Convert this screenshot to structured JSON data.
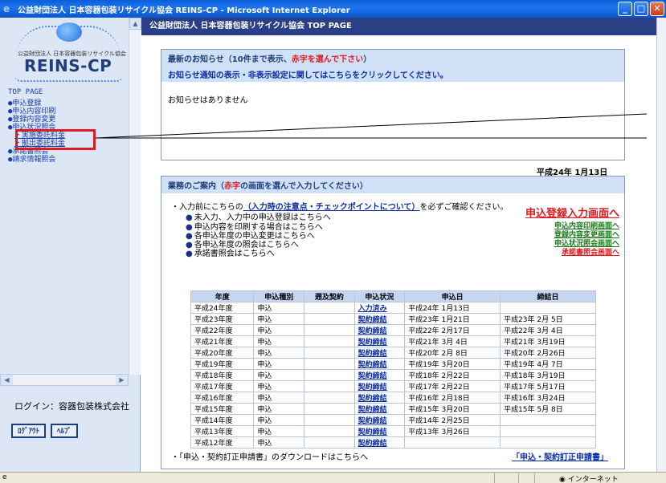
{
  "window": {
    "title": "公益財団法人 日本容器包装リサイクル協会 REINS-CP - Microsoft Internet Explorer"
  },
  "logo": {
    "subtitle": "公益財団法人 日本容器包装リサイクル協会",
    "main": "REINS-CP"
  },
  "nav": {
    "items": [
      {
        "label": "TOP PAGE"
      },
      {
        "label": "●申込登録"
      },
      {
        "label": "●申込内容印刷"
      },
      {
        "label": "●登録内容変更"
      },
      {
        "label": "●申込状況照会"
      },
      {
        "label": "・実施委託料金"
      },
      {
        "label": "・拠出委託料金"
      },
      {
        "label": "●承諾書照会"
      },
      {
        "label": "●請求情報照会"
      }
    ]
  },
  "login": {
    "text": "ログイン：容器包装株式会社"
  },
  "buttons": {
    "logout": "ﾛｸﾞｱｳﾄ",
    "help": "ﾍﾙﾌﾟ"
  },
  "main": {
    "header": "公益財団法人 日本容器包装リサイクル協会 TOP PAGE",
    "notice_title_prefix": "最新のお知らせ（10件まで表示、",
    "notice_title_red": "赤字を選んで下さい",
    "notice_title_suffix": "）",
    "notice_link": "お知らせ通知の表示・非表示設定に関してはこちらをクリックしてください。",
    "notice_empty": "お知らせはありません",
    "date": "平成24年 1月13日",
    "guide_title_prefix": "業務のご案内（",
    "guide_title_red": "赤字",
    "guide_title_suffix": "の画面を選んで入力してください）",
    "pre_check_prefix": "・入力前にこちらの",
    "pre_check_link": "（入力時の注意点・チェックポイントについて）",
    "pre_check_suffix": "を必ずご確認ください。",
    "actions": [
      {
        "text": "未入力、入力中の申込登録はこちらへ",
        "link": "申込登録入力画面へ"
      },
      {
        "text": "申込内容を印刷する場合はこちらへ",
        "link": "申込内容印刷画面へ"
      },
      {
        "text": "各申込年度の申込変更はこちらへ",
        "link": "登録内容変更画面へ"
      },
      {
        "text": "各申込年度の照会はこちらへ",
        "link": "申込状況照会画面へ"
      },
      {
        "text": "承諾書照会はこちらへ",
        "link": "承諾書照会画面へ"
      }
    ],
    "table": {
      "headers": [
        "年度",
        "申込種別",
        "遡及契約",
        "申込状況",
        "申込日",
        "締結日"
      ],
      "rows": [
        [
          "平成24年度",
          "申込",
          "",
          "入力済み",
          "平成24年 1月13日",
          ""
        ],
        [
          "平成23年度",
          "申込",
          "",
          "契約締結",
          "平成23年 1月21日",
          "平成23年 2月 5日"
        ],
        [
          "平成22年度",
          "申込",
          "",
          "契約締結",
          "平成22年 2月17日",
          "平成22年 3月 4日"
        ],
        [
          "平成21年度",
          "申込",
          "",
          "契約締結",
          "平成21年 3月 4日",
          "平成21年 3月19日"
        ],
        [
          "平成20年度",
          "申込",
          "",
          "契約締結",
          "平成20年 2月 8日",
          "平成20年 2月26日"
        ],
        [
          "平成19年度",
          "申込",
          "",
          "契約締結",
          "平成19年 3月20日",
          "平成19年 4月 7日"
        ],
        [
          "平成18年度",
          "申込",
          "",
          "契約締結",
          "平成18年 2月22日",
          "平成18年 3月19日"
        ],
        [
          "平成17年度",
          "申込",
          "",
          "契約締結",
          "平成17年 2月22日",
          "平成17年 5月17日"
        ],
        [
          "平成16年度",
          "申込",
          "",
          "契約締結",
          "平成16年 2月18日",
          "平成16年 3月24日"
        ],
        [
          "平成15年度",
          "申込",
          "",
          "契約締結",
          "平成15年 3月20日",
          "平成15年 5月 8日"
        ],
        [
          "平成14年度",
          "申込",
          "",
          "契約締結",
          "平成14年 2月25日",
          ""
        ],
        [
          "平成13年度",
          "申込",
          "",
          "契約締結",
          "平成13年 3月26日",
          ""
        ],
        [
          "平成12年度",
          "申込",
          "",
          "契約締結",
          "",
          ""
        ]
      ]
    },
    "download_text": "・「申込・契約訂正申請書」のダウンロードはこちらへ",
    "download_link": "「申込・契約訂正申請書」"
  },
  "statusbar": {
    "zone": "インターネット"
  }
}
